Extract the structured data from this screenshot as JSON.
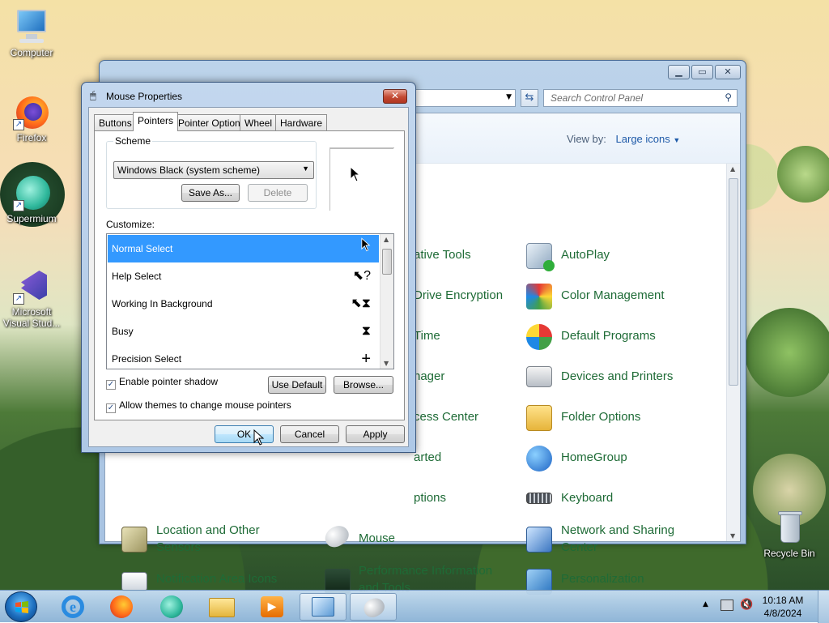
{
  "desktop": {
    "icons": [
      {
        "label": "Computer"
      },
      {
        "label": "Firefox"
      },
      {
        "label": "Supermium"
      },
      {
        "label": "Microsoft Visual Stud..."
      },
      {
        "label": "Recycle Bin"
      }
    ]
  },
  "control_panel": {
    "search_placeholder": "Search Control Panel",
    "view_by_label": "View by:",
    "view_by_value": "Large icons",
    "items": [
      {
        "label": "ative Tools"
      },
      {
        "label": "Drive Encryption"
      },
      {
        "label": "Time"
      },
      {
        "label": "nager"
      },
      {
        "label": "cess Center"
      },
      {
        "label": "arted"
      },
      {
        "label": "ptions"
      },
      {
        "label": "AutoPlay"
      },
      {
        "label": "Color Management"
      },
      {
        "label": "Default Programs"
      },
      {
        "label": "Devices and Printers"
      },
      {
        "label": "Folder Options"
      },
      {
        "label": "HomeGroup"
      },
      {
        "label": "Keyboard"
      },
      {
        "label": "Location and Other Sensors"
      },
      {
        "label": "Mouse"
      },
      {
        "label": "Network and Sharing Center"
      },
      {
        "label": "Notification Area Icons"
      },
      {
        "label": "Performance Information and Tools"
      },
      {
        "label": "Personalization"
      }
    ]
  },
  "dialog": {
    "title": "Mouse Properties",
    "tabs": [
      "Buttons",
      "Pointers",
      "Pointer Options",
      "Wheel",
      "Hardware"
    ],
    "active_tab": "Pointers",
    "scheme": {
      "legend": "Scheme",
      "selected": "Windows Black (system scheme)",
      "save_as_label": "Save As...",
      "delete_label": "Delete"
    },
    "customize_label": "Customize:",
    "cursor_rows": [
      {
        "label": "Normal Select",
        "cursor": "arrow-cursor"
      },
      {
        "label": "Help Select",
        "cursor": "help-cursor"
      },
      {
        "label": "Working In Background",
        "cursor": "working-cursor"
      },
      {
        "label": "Busy",
        "cursor": "hourglass-cursor"
      },
      {
        "label": "Precision Select",
        "cursor": "crosshair-cursor"
      }
    ],
    "enable_shadow_label": "Enable pointer shadow",
    "enable_shadow_checked": true,
    "allow_themes_label": "Allow themes to change mouse pointers",
    "allow_themes_checked": true,
    "use_default_label": "Use Default",
    "browse_label": "Browse...",
    "ok_label": "OK",
    "cancel_label": "Cancel",
    "apply_label": "Apply"
  },
  "taskbar": {
    "time": "10:18 AM",
    "date": "4/8/2024"
  },
  "colors": {
    "selection_blue": "#3399ff",
    "cp_link_green": "#1e6b36",
    "link_blue": "#1e5aa8"
  }
}
